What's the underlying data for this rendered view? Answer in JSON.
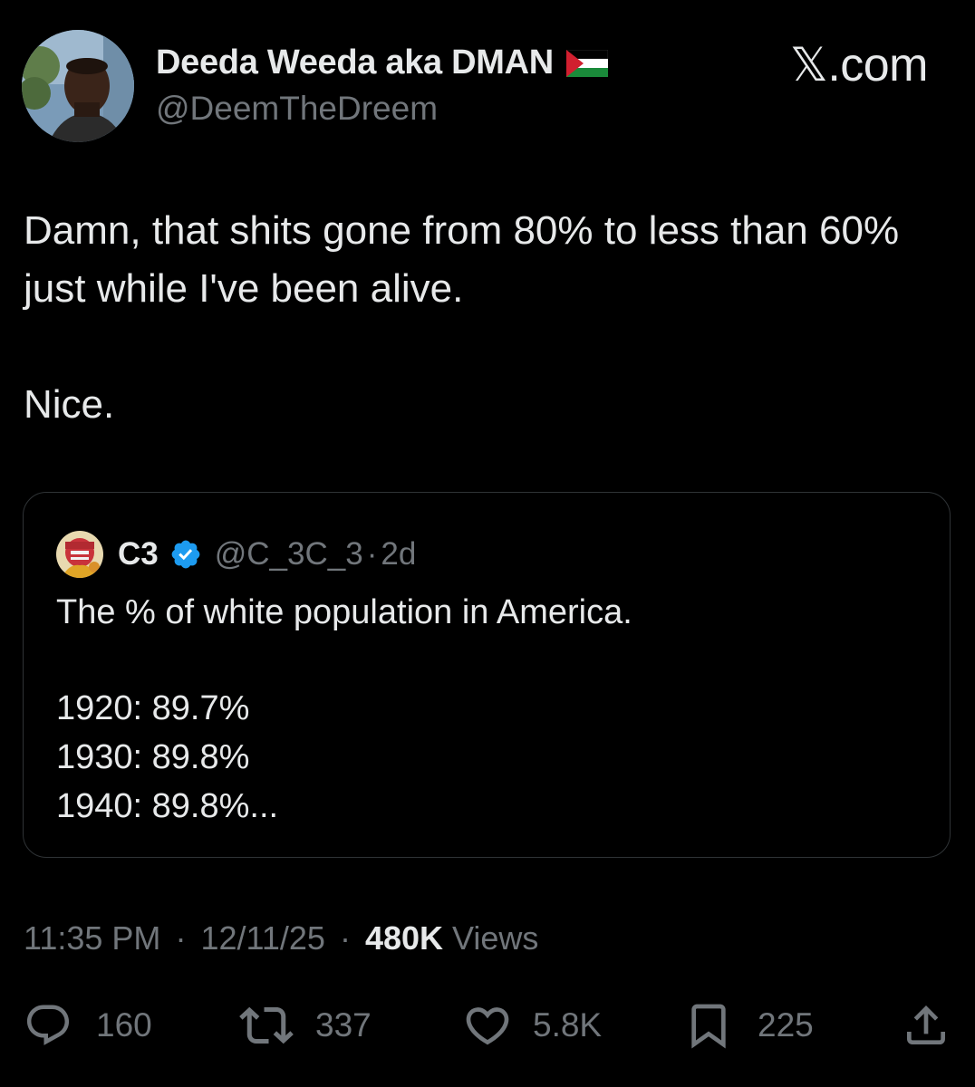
{
  "tweet": {
    "author": {
      "display_name": "Deeda Weeda aka DMAN",
      "handle": "@DeemTheDreem"
    },
    "watermark": "𝕏.com",
    "text_paragraphs": [
      "Damn, that shits gone from 80% to less than 60% just while I've been alive.",
      "Nice."
    ],
    "quoted": {
      "name": "C3",
      "handle": "@C_3C_3",
      "separator": "·",
      "age": "2d",
      "line1": "The % of white population in America.",
      "data_lines": [
        "1920: 89.7%",
        "1930: 89.8%",
        "1940: 89.8%..."
      ]
    },
    "meta": {
      "time": "11:35 PM",
      "separator": "·",
      "date": "12/11/25",
      "views_count": "480K",
      "views_label": "Views"
    },
    "actions": {
      "replies": "160",
      "reposts": "337",
      "likes": "5.8K",
      "bookmarks": "225"
    },
    "colors": {
      "background": "#000000",
      "text": "#e7e9ea",
      "secondary": "#71767b",
      "border": "#2f3336",
      "verified": "#1d9bf0"
    }
  }
}
